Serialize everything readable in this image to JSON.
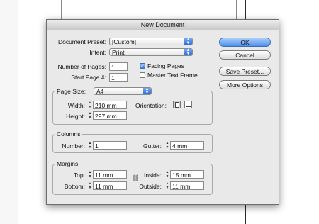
{
  "dialog": {
    "title": "New Document",
    "document_preset_label": "Document Preset:",
    "document_preset_value": "[Custom]",
    "intent_label": "Intent:",
    "intent_value": "Print",
    "number_of_pages_label": "Number of Pages:",
    "number_of_pages_value": "1",
    "start_page_label": "Start Page #:",
    "start_page_value": "1",
    "facing_pages_label": "Facing Pages",
    "facing_pages_checked": true,
    "master_text_frame_label": "Master Text Frame",
    "master_text_frame_checked": false,
    "page_size_label": "Page Size:",
    "page_size_value": "A4",
    "width_label": "Width:",
    "width_value": "210 mm",
    "height_label": "Height:",
    "height_value": "297 mm",
    "orientation_label": "Orientation:",
    "orientation_selected": "portrait",
    "columns_group_label": "Columns",
    "columns_number_label": "Number:",
    "columns_number_value": "1",
    "gutter_label": "Gutter:",
    "gutter_value": "4 mm",
    "margins_group_label": "Margins",
    "top_label": "Top:",
    "top_value": "11 mm",
    "bottom_label": "Bottom:",
    "bottom_value": "11 mm",
    "inside_label": "Inside:",
    "inside_value": "15 mm",
    "outside_label": "Outside:",
    "outside_value": "11 mm"
  },
  "buttons": {
    "ok": "OK",
    "cancel": "Cancel",
    "save_preset": "Save Preset...",
    "more_options": "More Options"
  },
  "colors": {
    "dialog_bg": "#e9e9e9",
    "accent_blue": "#4f90ec"
  }
}
